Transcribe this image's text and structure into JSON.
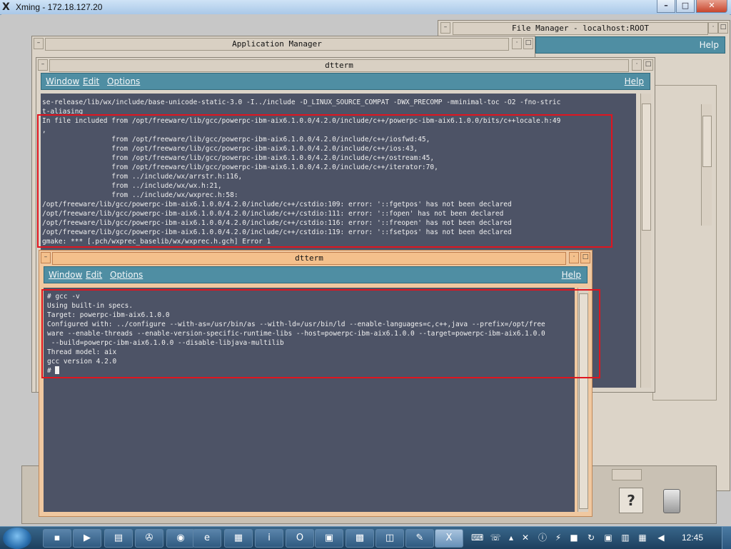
{
  "xming": {
    "title": "Xming - 172.18.127.20",
    "minimize": "–",
    "maximize": "□",
    "close": "✕"
  },
  "file_manager": {
    "title": "File Manager - localhost:ROOT",
    "help": "Help"
  },
  "app_manager": {
    "title": "Application Manager"
  },
  "dtterm_top": {
    "title": "dtterm",
    "menu": {
      "window": "Window",
      "edit": "Edit",
      "options": "Options",
      "help": "Help"
    },
    "lines": [
      "se-release/lib/wx/include/base-unicode-static-3.0 -I../include -D_LINUX_SOURCE_COMPAT -DWX_PRECOMP -mminimal-toc -O2 -fno-stric",
      "t-aliasing",
      "In file included from /opt/freeware/lib/gcc/powerpc-ibm-aix6.1.0.0/4.2.0/include/c++/powerpc-ibm-aix6.1.0.0/bits/c++locale.h:49",
      ",",
      "                 from /opt/freeware/lib/gcc/powerpc-ibm-aix6.1.0.0/4.2.0/include/c++/iosfwd:45,",
      "                 from /opt/freeware/lib/gcc/powerpc-ibm-aix6.1.0.0/4.2.0/include/c++/ios:43,",
      "                 from /opt/freeware/lib/gcc/powerpc-ibm-aix6.1.0.0/4.2.0/include/c++/ostream:45,",
      "                 from /opt/freeware/lib/gcc/powerpc-ibm-aix6.1.0.0/4.2.0/include/c++/iterator:70,",
      "                 from ../include/wx/arrstr.h:116,",
      "                 from ../include/wx/wx.h:21,",
      "                 from ../include/wx/wxprec.h:58:",
      "/opt/freeware/lib/gcc/powerpc-ibm-aix6.1.0.0/4.2.0/include/c++/cstdio:109: error: '::fgetpos' has not been declared",
      "/opt/freeware/lib/gcc/powerpc-ibm-aix6.1.0.0/4.2.0/include/c++/cstdio:111: error: '::fopen' has not been declared",
      "/opt/freeware/lib/gcc/powerpc-ibm-aix6.1.0.0/4.2.0/include/c++/cstdio:116: error: '::freopen' has not been declared",
      "/opt/freeware/lib/gcc/powerpc-ibm-aix6.1.0.0/4.2.0/include/c++/cstdio:119: error: '::fsetpos' has not been declared",
      "gmake: *** [.pch/wxprec_baselib/wx/wxprec.h.gch] Error 1"
    ]
  },
  "dtterm_bottom": {
    "title": "dtterm",
    "menu": {
      "window": "Window",
      "edit": "Edit",
      "options": "Options",
      "help": "Help"
    },
    "lines": [
      "# gcc -v",
      "Using built-in specs.",
      "Target: powerpc-ibm-aix6.1.0.0",
      "Configured with: ../configure --with-as=/usr/bin/as --with-ld=/usr/bin/ld --enable-languages=c,c++,java --prefix=/opt/free",
      "ware --enable-threads --enable-version-specific-runtime-libs --host=powerpc-ibm-aix6.1.0.0 --target=powerpc-ibm-aix6.1.0.0",
      " --build=powerpc-ibm-aix6.1.0.0 --disable-libjava-multilib",
      "Thread model: aix",
      "gcc version 4.2.0",
      "# "
    ]
  },
  "front_panel": {
    "help_label": "?"
  },
  "taskbar": {
    "buttons": [
      {
        "name": "cmd-button",
        "glyph": "▪"
      },
      {
        "name": "media-button",
        "glyph": "▶"
      },
      {
        "name": "explorer-button",
        "glyph": "▤"
      },
      {
        "name": "reel-button",
        "glyph": "✇"
      },
      {
        "name": "firefox-button",
        "glyph": "◉"
      },
      {
        "name": "ie-button",
        "glyph": "e"
      },
      {
        "name": "notepad-button",
        "glyph": "▦"
      },
      {
        "name": "info-button",
        "glyph": "i"
      },
      {
        "name": "outlook-button",
        "glyph": "O"
      },
      {
        "name": "remote-button",
        "glyph": "▣"
      },
      {
        "name": "network-button",
        "glyph": "▩"
      },
      {
        "name": "monitor-button",
        "glyph": "◫"
      },
      {
        "name": "paint-button",
        "glyph": "✎"
      },
      {
        "name": "xming-button",
        "glyph": "X"
      }
    ],
    "clock": "12:45"
  }
}
